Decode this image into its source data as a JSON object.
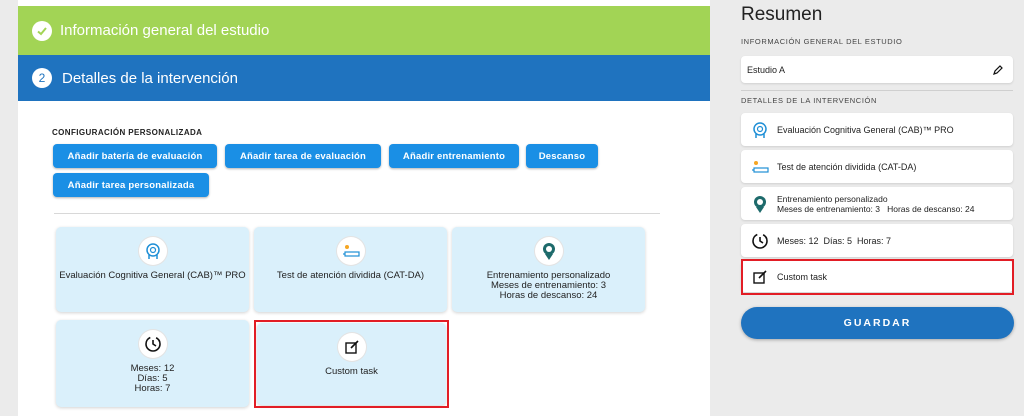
{
  "steps": {
    "step1": {
      "label": "Información general del estudio"
    },
    "step2": {
      "number": "2",
      "label": "Detalles de la intervención"
    }
  },
  "config": {
    "title": "CONFIGURACIÓN PERSONALIZADA",
    "buttons": {
      "bateria": "Añadir batería de evaluación",
      "tarea": "Añadir tarea de evaluación",
      "entrenamiento": "Añadir entrenamiento",
      "descanso": "Descanso",
      "personalizada": "Añadir tarea personalizada"
    }
  },
  "cards": {
    "cab": {
      "title": "Evaluación Cognitiva General (CAB)™ PRO",
      "icon": "brain-head-icon"
    },
    "catda": {
      "title": "Test de atención dividida (CAT-DA)",
      "icon": "attention-test-icon"
    },
    "training": {
      "title": "Entrenamiento personalizado",
      "line2": "Meses de entrenamiento: 3",
      "line3": "Horas de descanso: 24",
      "icon": "training-badge-icon"
    },
    "rest": {
      "line1": "Meses: 12",
      "line2": "Días: 5",
      "line3": "Horas: 7",
      "icon": "clock-icon"
    },
    "custom": {
      "title": "Custom task",
      "icon": "edit-icon"
    }
  },
  "summary": {
    "title": "Resumen",
    "info_label": "INFORMACIÓN GENERAL DEL ESTUDIO",
    "study_name": "Estudio A",
    "details_label": "DETALLES DE LA INTERVENCIÓN",
    "items": {
      "cab": "Evaluación Cognitiva General (CAB)™ PRO",
      "catda": "Test de atención dividida (CAT-DA)",
      "training_line1": "Entrenamiento personalizado",
      "training_line2": "Meses de entrenamiento: 3   Horas de descanso: 24",
      "rest": "Meses: 12  Días: 5  Horas: 7",
      "custom": "Custom task"
    },
    "save": "GUARDAR"
  },
  "colors": {
    "green": "#a2d455",
    "blue": "#1f73bf",
    "button": "#1a8fe5",
    "card": "#daf0fb",
    "highlight": "#e21d25"
  }
}
